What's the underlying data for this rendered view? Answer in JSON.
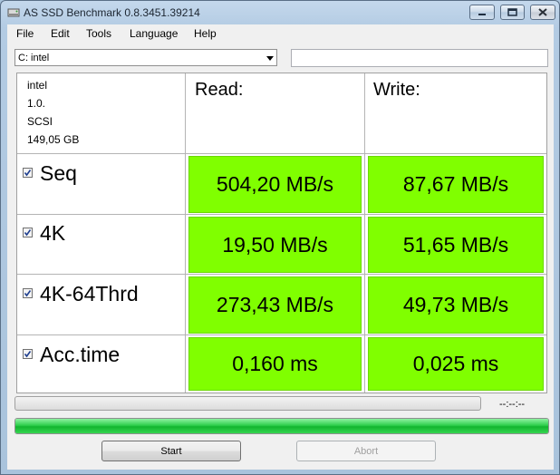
{
  "window": {
    "title": "AS SSD Benchmark 0.8.3451.39214"
  },
  "menu": [
    {
      "label": "File"
    },
    {
      "label": "Edit"
    },
    {
      "label": "Tools"
    },
    {
      "label": "Language"
    },
    {
      "label": "Help"
    }
  ],
  "drive_select": {
    "value": "C: intel"
  },
  "path_field": {
    "value": ""
  },
  "drive_info": {
    "name": "intel",
    "firmware": "1.0.",
    "controller": "SCSI",
    "size": "149,05 GB"
  },
  "columns": {
    "read": "Read:",
    "write": "Write:"
  },
  "rows": [
    {
      "label": "Seq",
      "checked": true,
      "read": "504,20 MB/s",
      "write": "87,67 MB/s"
    },
    {
      "label": "4K",
      "checked": true,
      "read": "19,50 MB/s",
      "write": "51,65 MB/s"
    },
    {
      "label": "4K-64Thrd",
      "checked": true,
      "read": "273,43 MB/s",
      "write": "49,73 MB/s"
    },
    {
      "label": "Acc.time",
      "checked": true,
      "read": "0,160 ms",
      "write": "0,025 ms"
    }
  ],
  "status": {
    "elapsed": "--:--:--",
    "test_progress": 0,
    "overall_progress": 1.0
  },
  "buttons": {
    "start": "Start",
    "abort": "Abort"
  },
  "colors": {
    "result_cell": "#80ff00",
    "progress_fill": "#13b52f"
  },
  "icons": {
    "app": "drive-icon",
    "minimize": "minimize-icon",
    "maximize": "maximize-icon",
    "close": "close-icon",
    "checkbox": "checkmark-icon",
    "dropdown": "chevron-down-icon"
  }
}
